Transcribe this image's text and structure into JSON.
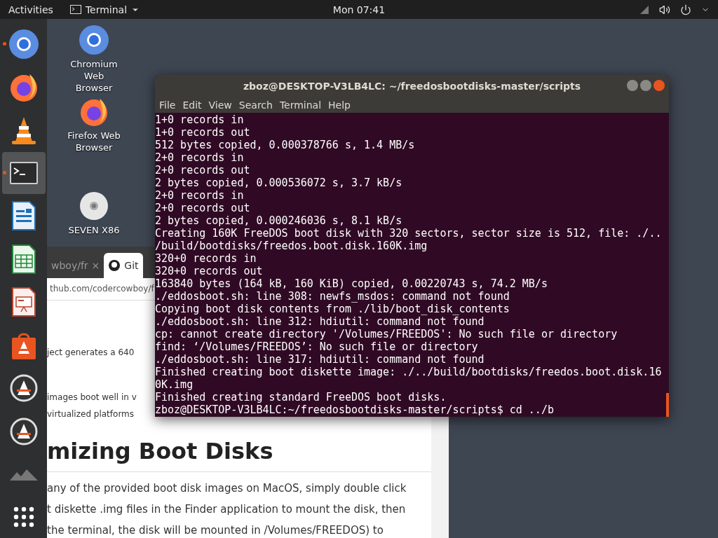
{
  "top_bar": {
    "activities": "Activities",
    "app_menu": "Terminal",
    "clock": "Mon 07:41"
  },
  "dock": [
    {
      "kind": "chromium",
      "running": true,
      "selected": false
    },
    {
      "kind": "firefox",
      "running": false,
      "selected": false
    },
    {
      "kind": "vlc",
      "running": false,
      "selected": false
    },
    {
      "kind": "terminal",
      "running": true,
      "selected": true
    },
    {
      "kind": "writer",
      "running": false,
      "selected": false
    },
    {
      "kind": "calc",
      "running": false,
      "selected": false
    },
    {
      "kind": "impress",
      "running": false,
      "selected": false
    },
    {
      "kind": "software",
      "running": false,
      "selected": false
    },
    {
      "kind": "updater",
      "running": false,
      "selected": false
    },
    {
      "kind": "updater",
      "running": false,
      "selected": false
    },
    {
      "kind": "faded",
      "running": false,
      "selected": false
    },
    {
      "kind": "grid",
      "running": false,
      "selected": false
    }
  ],
  "desktop_icons": [
    {
      "kind": "chromium",
      "label": "Chromium Web Browser"
    },
    {
      "kind": "firefox",
      "label": "Firefox Web Browser"
    },
    {
      "kind": "disc",
      "label": "SEVEN X86"
    }
  ],
  "browser": {
    "tabs": [
      {
        "label": "wboy/fr",
        "selected": false,
        "close": "×"
      },
      {
        "label": "Git",
        "selected": true
      }
    ],
    "url": "thub.com/codercowboy/f",
    "intro": [
      "ject generates a 640",
      "images boot well in v",
      "virtualized platforms"
    ],
    "heading": "mizing Boot Disks",
    "paragraph": [
      "any of the provided boot disk images on MacOS, simply double click",
      "t diskette .img files in the Finder application to mount the disk, then",
      "the terminal, the disk will be mounted in /Volumes/FREEDOS) to"
    ]
  },
  "terminal": {
    "title": "zboz@DESKTOP-V3LB4LC: ~/freedosbootdisks-master/scripts",
    "menu": [
      "File",
      "Edit",
      "View",
      "Search",
      "Terminal",
      "Help"
    ],
    "lines": [
      "1+0 records in",
      "1+0 records out",
      "512 bytes copied, 0.000378766 s, 1.4 MB/s",
      "2+0 records in",
      "2+0 records out",
      "2 bytes copied, 0.000536072 s, 3.7 kB/s",
      "2+0 records in",
      "2+0 records out",
      "2 bytes copied, 0.000246036 s, 8.1 kB/s",
      "Creating 160K FreeDOS boot disk with 320 sectors, sector size is 512, file: ./..",
      "/build/bootdisks/freedos.boot.disk.160K.img",
      "320+0 records in",
      "320+0 records out",
      "163840 bytes (164 kB, 160 KiB) copied, 0.00220743 s, 74.2 MB/s",
      "./eddosboot.sh: line 308: newfs_msdos: command not found",
      "Copying boot disk contents from ./lib/boot_disk_contents",
      "./eddosboot.sh: line 312: hdiutil: command not found",
      "cp: cannot create directory '/Volumes/FREEDOS': No such file or directory",
      "find: ‘/Volumes/FREEDOS’: No such file or directory",
      "./eddosboot.sh: line 317: hdiutil: command not found",
      "Finished creating boot diskette image: ./../build/bootdisks/freedos.boot.disk.16",
      "0K.img",
      "Finished creating standard FreeDOS boot disks."
    ],
    "prompt": "zboz@DESKTOP-V3LB4LC:~/freedosbootdisks-master/scripts$ cd ../b"
  }
}
